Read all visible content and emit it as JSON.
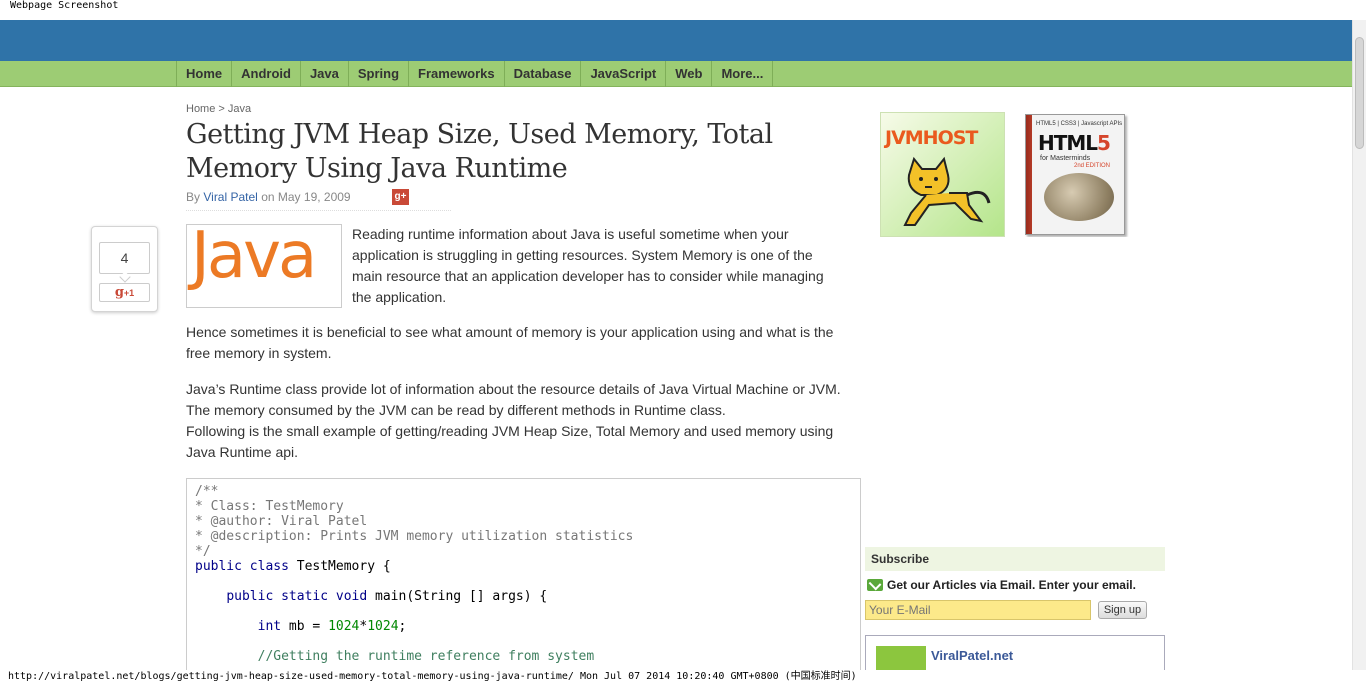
{
  "screenshot_label": "Webpage Screenshot",
  "nav": {
    "items": [
      "Home",
      "Android",
      "Java",
      "Spring",
      "Frameworks",
      "Database",
      "JavaScript",
      "Web",
      "More..."
    ]
  },
  "breadcrumb": {
    "home": "Home",
    "separator": ">",
    "current": "Java"
  },
  "article": {
    "title": "Getting JVM Heap Size, Used Memory, Total Memory Using Java Runtime",
    "by_label": "By",
    "author": "Viral Patel",
    "date_prefix": "on",
    "date": "May 19, 2009",
    "gplus_small": "g+",
    "share_count": "4",
    "share_gplus": "g",
    "share_gplus_suffix": "+1",
    "logo_text": "Java",
    "para1": "Reading runtime information about Java is useful sometime when your application is struggling in getting resources. System Memory is one of the main resource that an application developer has to consider while managing the application.",
    "para2": "Hence sometimes it is beneficial to see what amount of memory is your application using and what is the free memory in system.",
    "para3a": "Java’s Runtime class provide lot of information about the resource details of Java Virtual Machine or JVM. The memory consumed by the JVM can be read by different methods in Runtime class.",
    "para3b": "Following is the small example of getting/reading JVM Heap Size, Total Memory and used memory using Java Runtime api."
  },
  "code": {
    "c1": "/**",
    "c2": "* Class: TestMemory",
    "c3": "* @author: Viral Patel",
    "c4": "* @description: Prints JVM memory utilization statistics",
    "c5": "*/",
    "l6_kw": "public class",
    "l6_rest": " TestMemory {",
    "l8_kw": "public static void",
    "l8_rest": " main(String [] args) {",
    "l10_kw": "int",
    "l10_mid": " mb = ",
    "l10_n1": "1024",
    "l10_op": "*",
    "l10_n2": "1024",
    "l10_end": ";",
    "l12": "//Getting the runtime reference from system"
  },
  "sidebar": {
    "ad1_text": "JVMHOST",
    "ad2_top": "HTML5 | CSS3 | Javascript APIs",
    "ad2_title_a": "HTML",
    "ad2_title_b": "5",
    "ad2_sub": "for Masterminds",
    "ad2_edition": "2nd EDITION",
    "subscribe_title": "Subscribe",
    "subscribe_text": "Get our Articles via Email. Enter your email.",
    "email_placeholder": "Your E-Mail",
    "signup_label": "Sign up",
    "fb_name": "ViralPatel.net"
  },
  "statusbar": {
    "text": "http://viralpatel.net/blogs/getting-jvm-heap-size-used-memory-total-memory-using-java-runtime/ Mon Jul 07 2014 10:20:40 GMT+0800 (中国标准时间)"
  },
  "colors": {
    "header_blue": "#2f73a8",
    "nav_green": "#9dcc74",
    "link_blue": "#3464a6",
    "java_orange": "#ec7a25",
    "gplus_red": "#c94937",
    "email_yellow": "#fce98a"
  }
}
